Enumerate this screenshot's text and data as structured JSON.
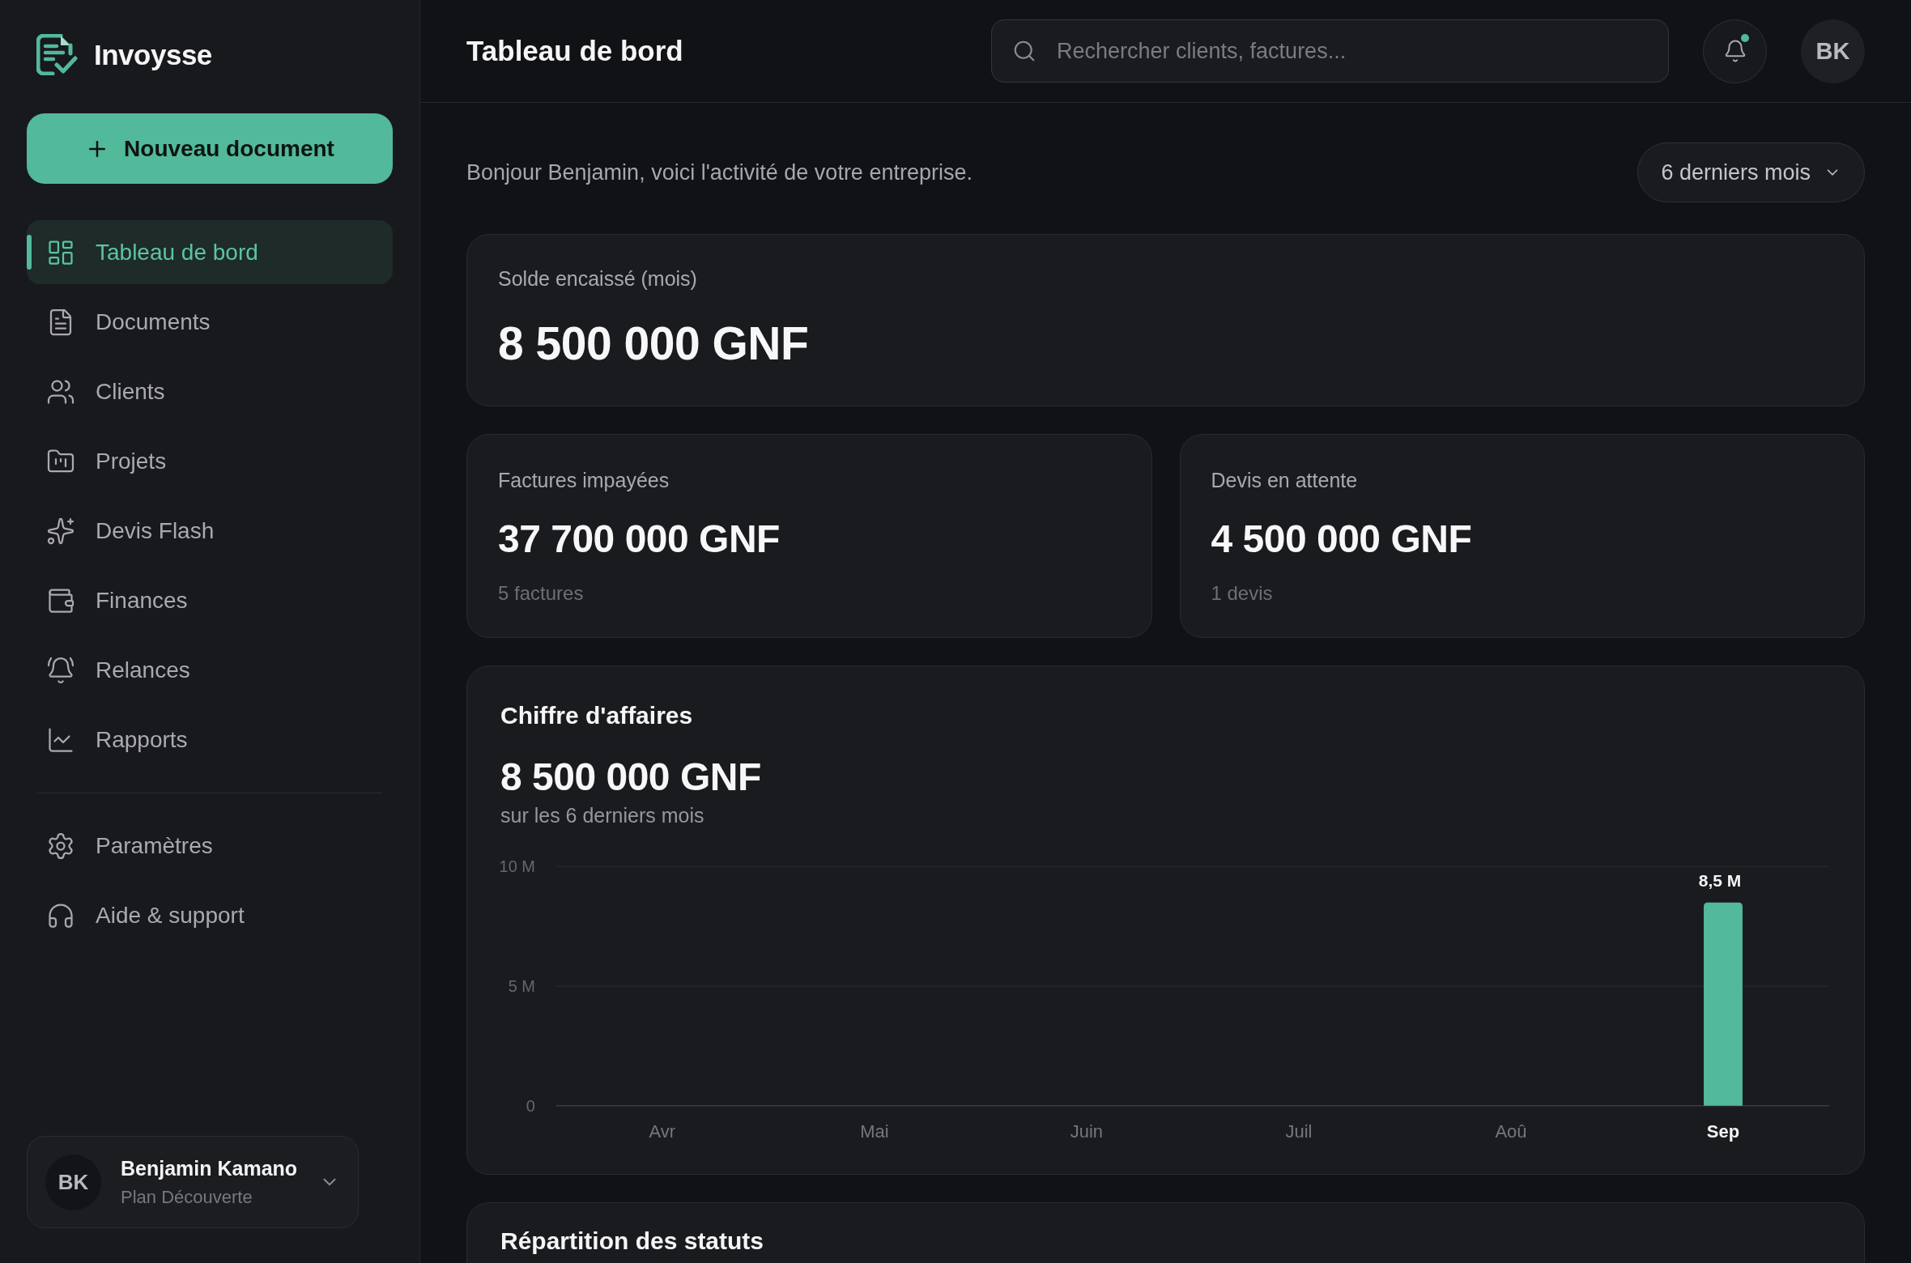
{
  "app": {
    "name": "Invoysse"
  },
  "sidebar": {
    "new_button": {
      "label": "Nouveau document"
    },
    "items": [
      {
        "label": "Tableau de bord",
        "selected": true
      },
      {
        "label": "Documents",
        "selected": false
      },
      {
        "label": "Clients",
        "selected": false
      },
      {
        "label": "Projets",
        "selected": false
      },
      {
        "label": "Devis Flash",
        "selected": false
      },
      {
        "label": "Finances",
        "selected": false
      },
      {
        "label": "Relances",
        "selected": false
      },
      {
        "label": "Rapports",
        "selected": false
      }
    ],
    "footer_items": [
      {
        "label": "Paramètres",
        "selected": false
      },
      {
        "label": "Aide & support",
        "selected": false
      }
    ],
    "user": {
      "initials": "BK",
      "name": "Benjamin Kamano",
      "plan": "Plan Découverte"
    }
  },
  "header": {
    "title": "Tableau de bord",
    "search": {
      "placeholder": "Rechercher clients, factures..."
    },
    "notifications": {
      "unread": true
    },
    "avatar": {
      "initials": "BK"
    }
  },
  "greeting": "Bonjour Benjamin, voici l'activité de votre entreprise.",
  "period_select": {
    "value": "6 derniers mois"
  },
  "balance": {
    "label": "Solde encaissé (mois)",
    "value": "8 500 000 GNF"
  },
  "stats": [
    {
      "label": "Factures impayées",
      "value": "37 700 000 GNF",
      "note": "5 factures"
    },
    {
      "label": "Devis en attente",
      "value": "4 500 000 GNF",
      "note": "1 devis"
    }
  ],
  "revenue": {
    "title": "Chiffre d'affaires",
    "total": "8 500 000 GNF",
    "subtitle": "sur les 6 derniers mois",
    "chart_data": {
      "type": "bar",
      "categories": [
        "Avr",
        "Mai",
        "Juin",
        "Juil",
        "Aoû",
        "Sep"
      ],
      "values": [
        0,
        0,
        0,
        0,
        0,
        8.5
      ],
      "ylim": [
        0,
        10
      ],
      "yticks": [
        {
          "value": 0,
          "label": "0"
        },
        {
          "value": 5,
          "label": "5 M"
        },
        {
          "value": 10,
          "label": "10 M"
        }
      ],
      "value_labels": [
        null,
        null,
        null,
        null,
        null,
        "8,5 M"
      ]
    }
  },
  "status_breakdown": {
    "title": "Répartition des statuts"
  }
}
